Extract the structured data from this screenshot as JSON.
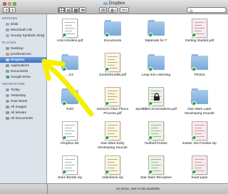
{
  "window": {
    "title": "Dropbox"
  },
  "sidebar": {
    "sections": [
      {
        "heading": "DEVICES",
        "items": [
          {
            "label": "iDisk",
            "icon": "disk-icon"
          },
          {
            "label": "Macintosh HD",
            "icon": "hard-drive-icon"
          },
          {
            "label": "Smarty Symbols 2012",
            "icon": "external-drive-icon"
          }
        ]
      },
      {
        "heading": "PLACES",
        "items": [
          {
            "label": "Desktop",
            "icon": "desktop-icon"
          },
          {
            "label": "jenniferalcorn",
            "icon": "home-icon"
          },
          {
            "label": "Dropbox",
            "icon": "dropbox-folder-icon",
            "selected": true
          },
          {
            "label": "Applications",
            "icon": "applications-icon"
          },
          {
            "label": "Documents",
            "icon": "documents-icon"
          },
          {
            "label": "Google Drive",
            "icon": "google-drive-icon"
          }
        ]
      },
      {
        "heading": "SEARCH FOR",
        "items": [
          {
            "label": "Today",
            "icon": "clock-icon"
          },
          {
            "label": "Yesterday",
            "icon": "clock-icon"
          },
          {
            "label": "Past Week",
            "icon": "clock-icon"
          },
          {
            "label": "All Images",
            "icon": "images-icon"
          },
          {
            "label": "All Movies",
            "icon": "movies-icon"
          },
          {
            "label": "All Documents",
            "icon": "documents-icon"
          }
        ]
      }
    ]
  },
  "files": [
    {
      "name": "ArticActivities.pdf",
      "kind": "doc"
    },
    {
      "name": "Documents",
      "kind": "folder"
    },
    {
      "name": "Materials for T",
      "kind": "folder"
    },
    {
      "name": "Getting Started.pdf",
      "kind": "doc"
    },
    {
      "name": "...ics",
      "kind": "folder"
    },
    {
      "name": "JumboReadW.pdf",
      "kind": "doc"
    },
    {
      "name": "Leap into Listening",
      "kind": "folder"
    },
    {
      "name": "Photos",
      "kind": "folder"
    },
    {
      "name": "Publ",
      "kind": "folder"
    },
    {
      "name": "Scissors Glue Phono Process.pdf",
      "kind": "doc"
    },
    {
      "name": "Spot$$leConversations.pdf",
      "kind": "lock"
    },
    {
      "name": "Star Wars Later Developing Sounds",
      "kind": "folder"
    },
    {
      "name": "Dropbox.lnk",
      "kind": "doc"
    },
    {
      "name": "Star Wars Early Developing Sounds",
      "kind": "doc"
    },
    {
      "name": "football freebie",
      "kind": "doc"
    },
    {
      "name": "Easter Set Freebie.zip",
      "kind": "zip"
    },
    {
      "name": "Stars Border.zip",
      "kind": "zip"
    },
    {
      "name": "Valentines.zip",
      "kind": "zip"
    },
    {
      "name": "Star Wars Receptive",
      "kind": "doc"
    },
    {
      "name": "heart pops",
      "kind": "doc"
    },
    {
      "name": "",
      "kind": "doc"
    },
    {
      "name": "",
      "kind": "doc"
    },
    {
      "name": "",
      "kind": "doc"
    },
    {
      "name": "",
      "kind": "doc"
    }
  ],
  "status": {
    "text": "34 items, 184.9 GB available"
  },
  "colors": {
    "selection": "#3b73c4",
    "sync_badge": "#26a33b",
    "annotation_arrow": "#f4f000"
  }
}
